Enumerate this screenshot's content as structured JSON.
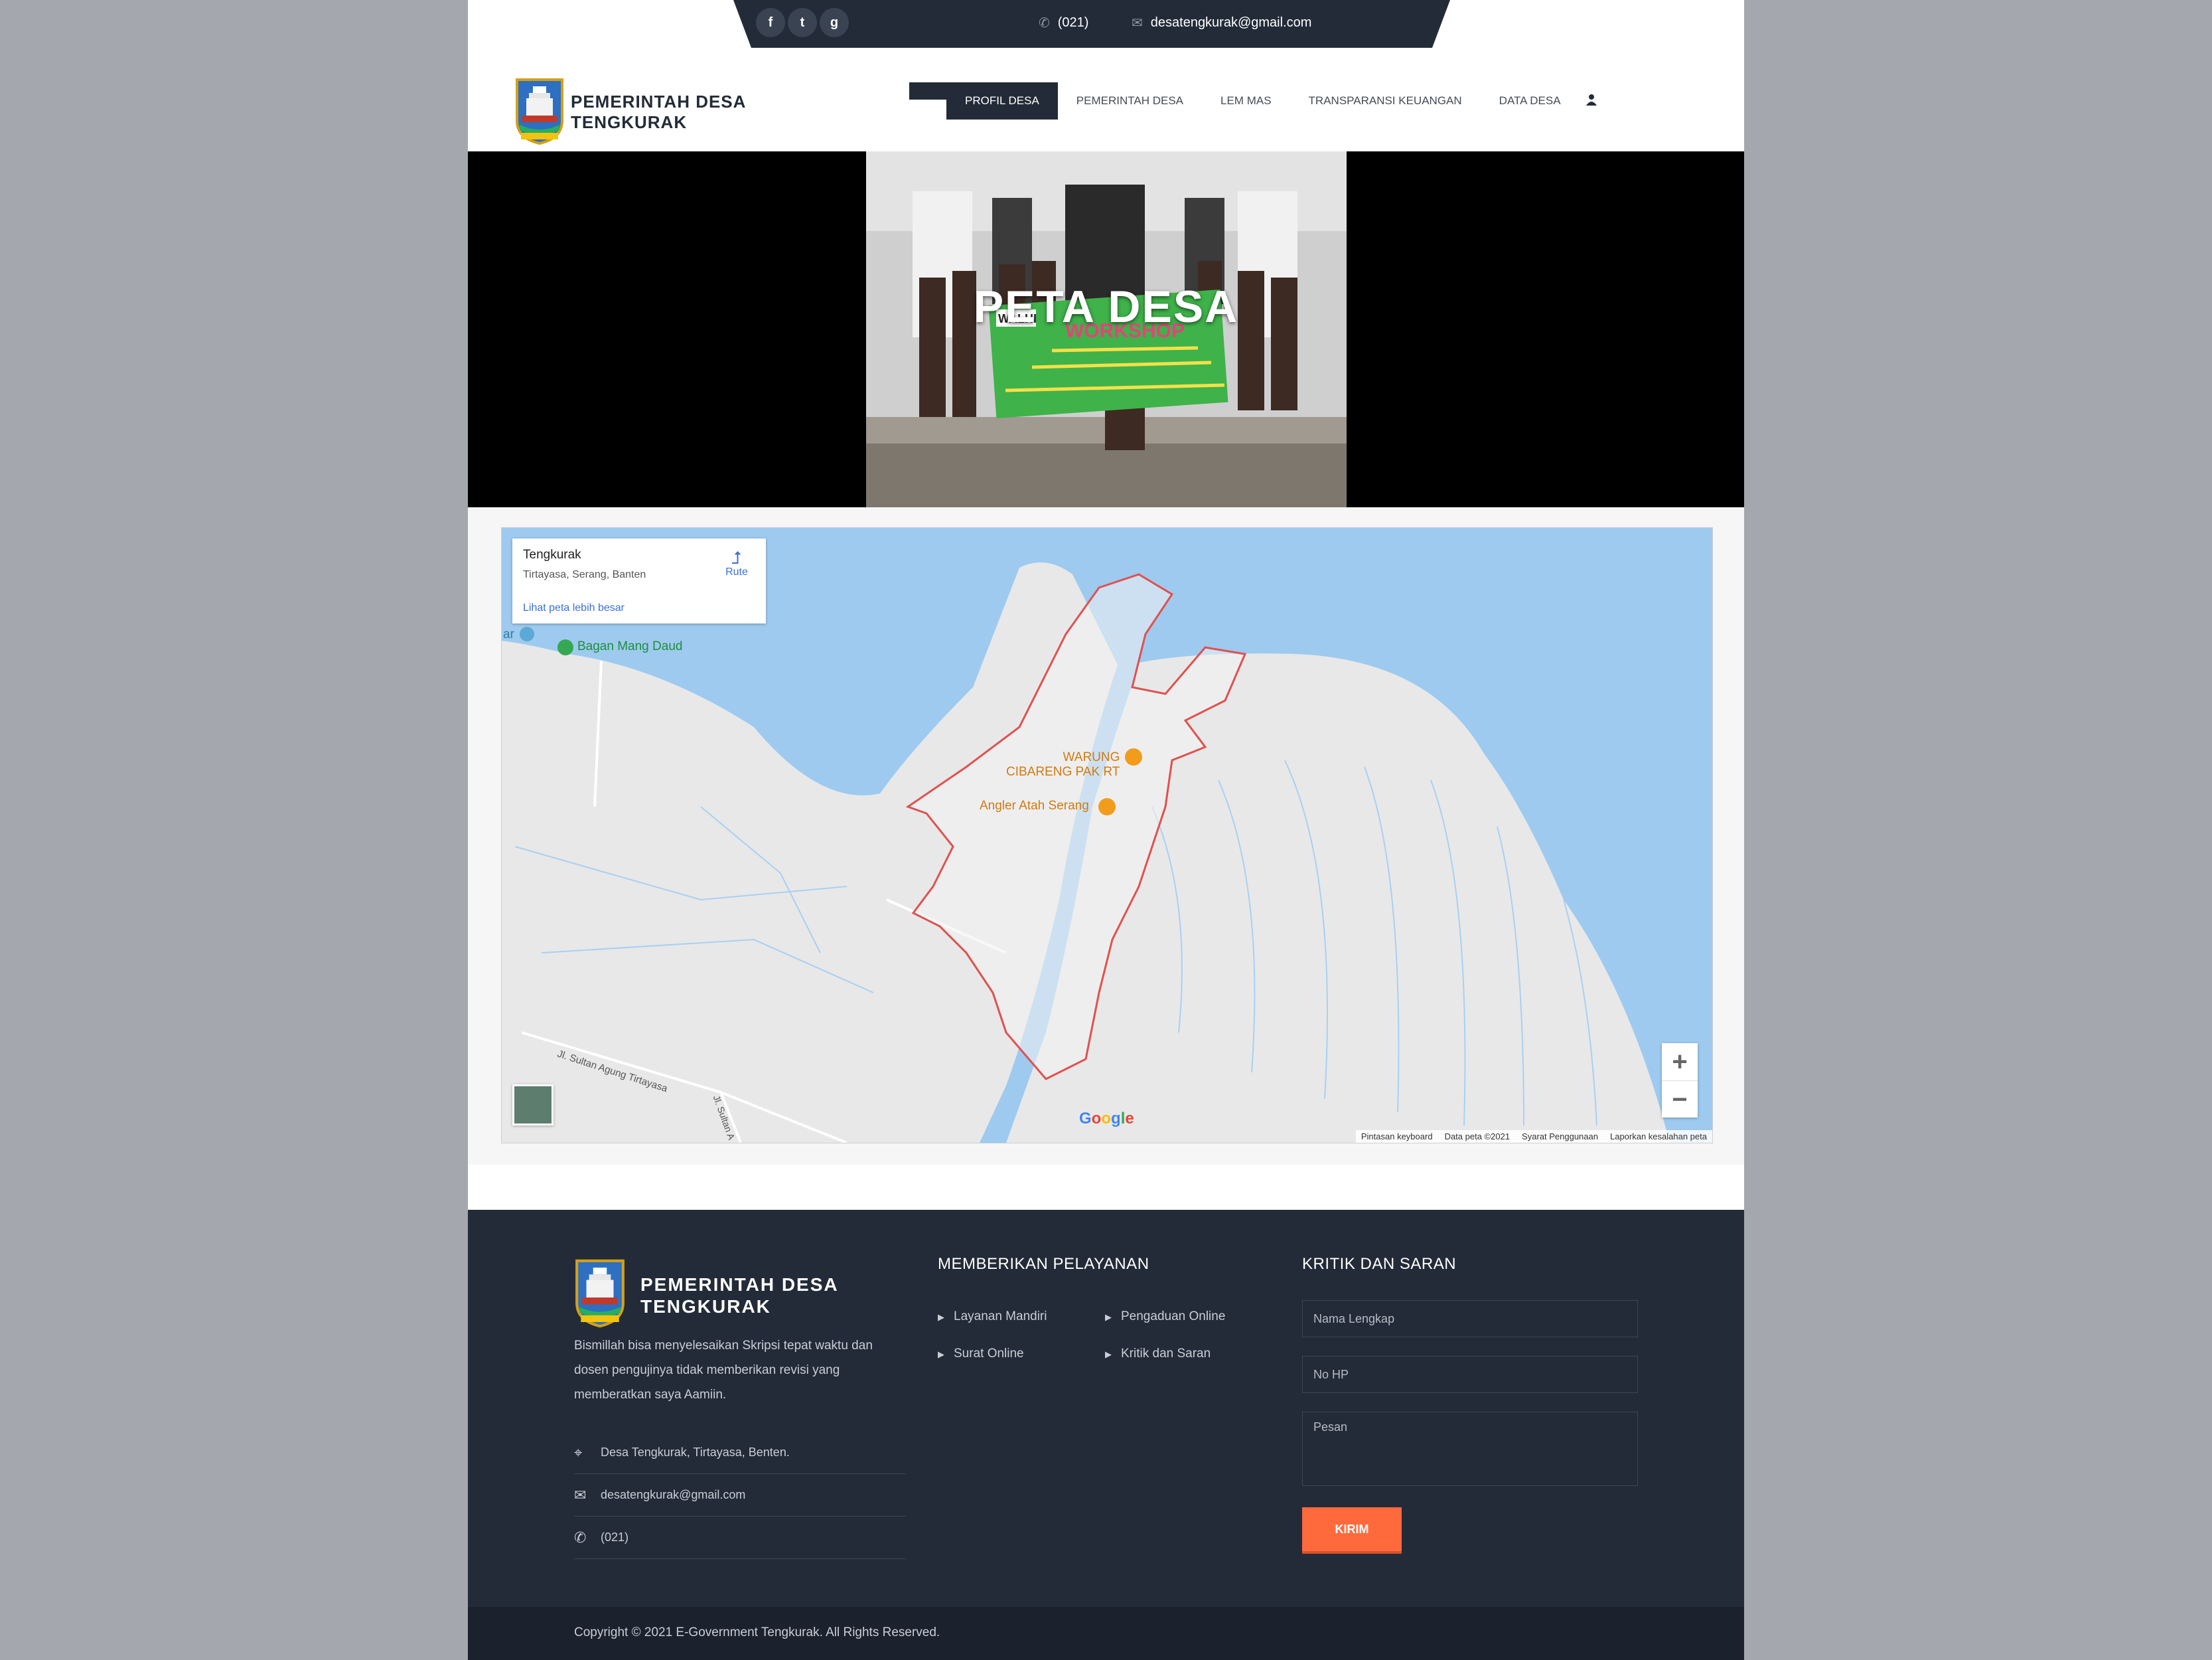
{
  "topbar": {
    "social": [
      {
        "name": "facebook-icon",
        "glyph": "f"
      },
      {
        "name": "twitter-icon",
        "glyph": "t"
      },
      {
        "name": "google-plus-icon",
        "glyph": "g"
      }
    ],
    "phone": "(021)",
    "email": "desatengkurak@gmail.com"
  },
  "brand": {
    "line1": "PEMERINTAH DESA",
    "line2": "TENGKURAK"
  },
  "nav": {
    "items": [
      "PROFIL DESA",
      "PEMERINTAH DESA",
      "LEM MAS",
      "TRANSPARANSI KEUANGAN",
      "DATA DESA"
    ],
    "user_icon": "user-icon"
  },
  "hero": {
    "title": "PETA DESA",
    "banner_text": "WORKSHOP",
    "banner_tag": "WALHI"
  },
  "map": {
    "place_title": "Tengkurak",
    "place_address": "Tirtayasa, Serang, Banten",
    "route_label": "Rute",
    "larger_map_link": "Lihat peta lebih besar",
    "poi": [
      "Bagan Mang Daud",
      "WARUNG",
      "CIBARENG PAK RT",
      "Angler Atah Serang",
      "ar"
    ],
    "roads": [
      "Jl. Sultan Agung Tirtayasa",
      "Jl. Sultan A"
    ],
    "logo": "Google",
    "attribution": [
      "Pintasan keyboard",
      "Data peta ©2021",
      "Syarat Penggunaan",
      "Laporkan kesalahan peta"
    ],
    "colors": {
      "water": "#9ecaef",
      "land": "#e8e8e8",
      "boundary": "#e0514f"
    }
  },
  "footer": {
    "brand_line1": "PEMERINTAH DESA",
    "brand_line2": "TENGKURAK",
    "description": "Bismillah bisa menyelesaikan Skripsi tepat waktu dan dosen pengujinya tidak memberikan revisi yang memberatkan saya Aamiin.",
    "address": "Desa Tengkurak, Tirtayasa, Benten.",
    "email": "desatengkurak@gmail.com",
    "phone": "(021)",
    "services_heading": "MEMBERIKAN PELAYANAN",
    "services": [
      "Layanan Mandiri",
      "Pengaduan Online",
      "Surat Online",
      "Kritik dan Saran"
    ],
    "feedback_heading": "KRITIK DAN SARAN",
    "form": {
      "name_placeholder": "Nama Lengkap",
      "phone_placeholder": "No HP",
      "message_placeholder": "Pesan",
      "submit": "KIRIM"
    },
    "copyright": "Copyright © 2021 E-Government Tengkurak. All Rights Reserved."
  },
  "colors": {
    "dark": "#232b38",
    "accent": "#ff6a3d"
  }
}
